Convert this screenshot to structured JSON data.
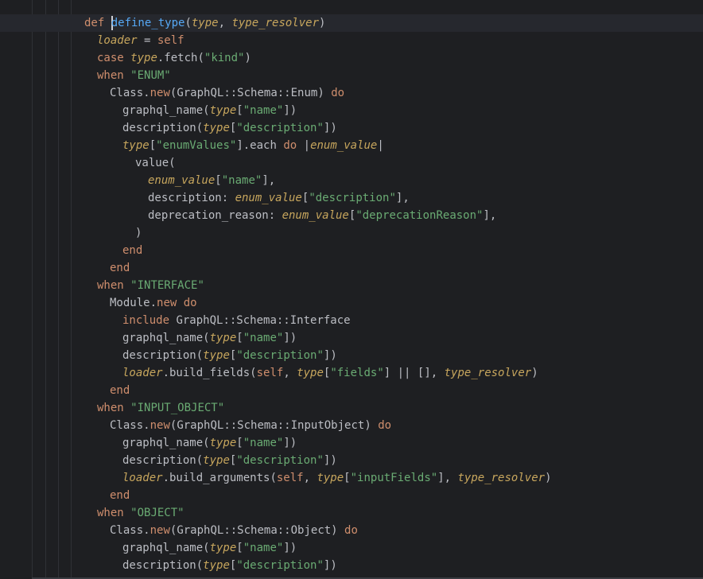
{
  "editor": {
    "lines": [
      [
        {
          "t": "def ",
          "c": "kw"
        },
        {
          "t": "define_type",
          "c": "fn"
        },
        {
          "t": "(",
          "c": "plain"
        },
        {
          "t": "type",
          "c": "ivar"
        },
        {
          "t": ", ",
          "c": "plain"
        },
        {
          "t": "type_resolver",
          "c": "ivar"
        },
        {
          "t": ")",
          "c": "plain"
        }
      ],
      [
        {
          "t": "loader",
          "c": "ivar"
        },
        {
          "t": " = ",
          "c": "plain"
        },
        {
          "t": "self",
          "c": "kw"
        }
      ],
      [
        {
          "t": "case ",
          "c": "kw"
        },
        {
          "t": "type",
          "c": "ivar"
        },
        {
          "t": ".fetch(",
          "c": "plain"
        },
        {
          "t": "\"kind\"",
          "c": "str"
        },
        {
          "t": ")",
          "c": "plain"
        }
      ],
      [
        {
          "t": "when ",
          "c": "kw"
        },
        {
          "t": "\"ENUM\"",
          "c": "str"
        }
      ],
      [
        {
          "t": "Class",
          "c": "const"
        },
        {
          "t": ".",
          "c": "plain"
        },
        {
          "t": "new",
          "c": "kw"
        },
        {
          "t": "(GraphQL::Schema::Enum) ",
          "c": "plain"
        },
        {
          "t": "do",
          "c": "kw"
        }
      ],
      [
        {
          "t": "graphql_name(",
          "c": "plain"
        },
        {
          "t": "type",
          "c": "ivar"
        },
        {
          "t": "[",
          "c": "plain"
        },
        {
          "t": "\"name\"",
          "c": "str"
        },
        {
          "t": "])",
          "c": "plain"
        }
      ],
      [
        {
          "t": "description(",
          "c": "plain"
        },
        {
          "t": "type",
          "c": "ivar"
        },
        {
          "t": "[",
          "c": "plain"
        },
        {
          "t": "\"description\"",
          "c": "str"
        },
        {
          "t": "])",
          "c": "plain"
        }
      ],
      [
        {
          "t": "type",
          "c": "ivar"
        },
        {
          "t": "[",
          "c": "plain"
        },
        {
          "t": "\"enumValues\"",
          "c": "str"
        },
        {
          "t": "].each ",
          "c": "plain"
        },
        {
          "t": "do ",
          "c": "kw"
        },
        {
          "t": "|",
          "c": "plain"
        },
        {
          "t": "enum_value",
          "c": "ivar"
        },
        {
          "t": "|",
          "c": "plain"
        }
      ],
      [
        {
          "t": "value(",
          "c": "plain"
        }
      ],
      [
        {
          "t": "enum_value",
          "c": "ivar"
        },
        {
          "t": "[",
          "c": "plain"
        },
        {
          "t": "\"name\"",
          "c": "str"
        },
        {
          "t": "],",
          "c": "plain"
        }
      ],
      [
        {
          "t": "description: ",
          "c": "plain"
        },
        {
          "t": "enum_value",
          "c": "ivar"
        },
        {
          "t": "[",
          "c": "plain"
        },
        {
          "t": "\"description\"",
          "c": "str"
        },
        {
          "t": "],",
          "c": "plain"
        }
      ],
      [
        {
          "t": "deprecation_reason: ",
          "c": "plain"
        },
        {
          "t": "enum_value",
          "c": "ivar"
        },
        {
          "t": "[",
          "c": "plain"
        },
        {
          "t": "\"deprecationReason\"",
          "c": "str"
        },
        {
          "t": "],",
          "c": "plain"
        }
      ],
      [
        {
          "t": ")",
          "c": "plain"
        }
      ],
      [
        {
          "t": "end",
          "c": "kw"
        }
      ],
      [
        {
          "t": "end",
          "c": "kw"
        }
      ],
      [
        {
          "t": "when ",
          "c": "kw"
        },
        {
          "t": "\"INTERFACE\"",
          "c": "str"
        }
      ],
      [
        {
          "t": "Module",
          "c": "const"
        },
        {
          "t": ".",
          "c": "plain"
        },
        {
          "t": "new ",
          "c": "kw"
        },
        {
          "t": "do",
          "c": "kw"
        }
      ],
      [
        {
          "t": "include ",
          "c": "kw"
        },
        {
          "t": "GraphQL::Schema::Interface",
          "c": "plain"
        }
      ],
      [
        {
          "t": "graphql_name(",
          "c": "plain"
        },
        {
          "t": "type",
          "c": "ivar"
        },
        {
          "t": "[",
          "c": "plain"
        },
        {
          "t": "\"name\"",
          "c": "str"
        },
        {
          "t": "])",
          "c": "plain"
        }
      ],
      [
        {
          "t": "description(",
          "c": "plain"
        },
        {
          "t": "type",
          "c": "ivar"
        },
        {
          "t": "[",
          "c": "plain"
        },
        {
          "t": "\"description\"",
          "c": "str"
        },
        {
          "t": "])",
          "c": "plain"
        }
      ],
      [
        {
          "t": "loader",
          "c": "ivar"
        },
        {
          "t": ".build_fields(",
          "c": "plain"
        },
        {
          "t": "self",
          "c": "kw"
        },
        {
          "t": ", ",
          "c": "plain"
        },
        {
          "t": "type",
          "c": "ivar"
        },
        {
          "t": "[",
          "c": "plain"
        },
        {
          "t": "\"fields\"",
          "c": "str"
        },
        {
          "t": "] || [], ",
          "c": "plain"
        },
        {
          "t": "type_resolver",
          "c": "ivar"
        },
        {
          "t": ")",
          "c": "plain"
        }
      ],
      [
        {
          "t": "end",
          "c": "kw"
        }
      ],
      [
        {
          "t": "when ",
          "c": "kw"
        },
        {
          "t": "\"INPUT_OBJECT\"",
          "c": "str"
        }
      ],
      [
        {
          "t": "Class",
          "c": "const"
        },
        {
          "t": ".",
          "c": "plain"
        },
        {
          "t": "new",
          "c": "kw"
        },
        {
          "t": "(GraphQL::Schema::InputObject) ",
          "c": "plain"
        },
        {
          "t": "do",
          "c": "kw"
        }
      ],
      [
        {
          "t": "graphql_name(",
          "c": "plain"
        },
        {
          "t": "type",
          "c": "ivar"
        },
        {
          "t": "[",
          "c": "plain"
        },
        {
          "t": "\"name\"",
          "c": "str"
        },
        {
          "t": "])",
          "c": "plain"
        }
      ],
      [
        {
          "t": "description(",
          "c": "plain"
        },
        {
          "t": "type",
          "c": "ivar"
        },
        {
          "t": "[",
          "c": "plain"
        },
        {
          "t": "\"description\"",
          "c": "str"
        },
        {
          "t": "])",
          "c": "plain"
        }
      ],
      [
        {
          "t": "loader",
          "c": "ivar"
        },
        {
          "t": ".build_arguments(",
          "c": "plain"
        },
        {
          "t": "self",
          "c": "kw"
        },
        {
          "t": ", ",
          "c": "plain"
        },
        {
          "t": "type",
          "c": "ivar"
        },
        {
          "t": "[",
          "c": "plain"
        },
        {
          "t": "\"inputFields\"",
          "c": "str"
        },
        {
          "t": "], ",
          "c": "plain"
        },
        {
          "t": "type_resolver",
          "c": "ivar"
        },
        {
          "t": ")",
          "c": "plain"
        }
      ],
      [
        {
          "t": "end",
          "c": "kw"
        }
      ],
      [
        {
          "t": "when ",
          "c": "kw"
        },
        {
          "t": "\"OBJECT\"",
          "c": "str"
        }
      ],
      [
        {
          "t": "Class",
          "c": "const"
        },
        {
          "t": ".",
          "c": "plain"
        },
        {
          "t": "new",
          "c": "kw"
        },
        {
          "t": "(GraphQL::Schema::Object) ",
          "c": "plain"
        },
        {
          "t": "do",
          "c": "kw"
        }
      ],
      [
        {
          "t": "graphql_name(",
          "c": "plain"
        },
        {
          "t": "type",
          "c": "ivar"
        },
        {
          "t": "[",
          "c": "plain"
        },
        {
          "t": "\"name\"",
          "c": "str"
        },
        {
          "t": "])",
          "c": "plain"
        }
      ],
      [
        {
          "t": "description(",
          "c": "plain"
        },
        {
          "t": "type",
          "c": "ivar"
        },
        {
          "t": "[",
          "c": "plain"
        },
        {
          "t": "\"description\"",
          "c": "str"
        },
        {
          "t": "])",
          "c": "plain"
        }
      ]
    ]
  },
  "colors": {
    "background": "#1e1f22",
    "current_line": "#26282e",
    "keyword": "#cf8e6d",
    "function_name": "#56a8f5",
    "parameter": "#c7a65d",
    "string": "#6aab73",
    "text": "#bcbec4"
  }
}
